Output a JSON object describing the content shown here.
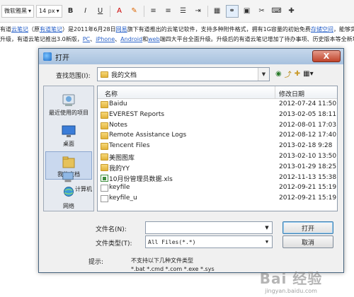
{
  "editor": {
    "font_name": "微软雅黑",
    "font_size": "14 px",
    "line1_parts": [
      "有道",
      "云笔记",
      "（原",
      "有道笔记",
      "）是2011年6月28日",
      "网易",
      "旗下有道推出的云笔记软件，支持多种附件格式，拥有1G容量的初始免费",
      "存储空间",
      "，能够实时"
    ],
    "line2_parts": [
      "升级，有道云笔记推出3.0新版，",
      "PC",
      "、",
      "iPhone",
      "、",
      "Android",
      "和",
      "web",
      "端四大平台全面升级。升级后的有道云笔记增加了待办事项、历史版本等全新功能，"
    ]
  },
  "dialog": {
    "title": "打开",
    "look_in_label": "查找范围(I):",
    "look_in_value": "我的文档",
    "places": [
      {
        "label": "最近使用的项目",
        "icon": "recent-icon"
      },
      {
        "label": "桌面",
        "icon": "desktop-icon"
      },
      {
        "label": "我的文档",
        "icon": "documents-icon"
      },
      {
        "label": "计算机",
        "icon": "computer-icon"
      },
      {
        "label": "网络",
        "icon": "network-icon"
      }
    ],
    "columns": {
      "name": "名称",
      "date": "修改日期"
    },
    "files": [
      {
        "name": "Baidu",
        "date": "2012-07-24 11:50",
        "type": "folder"
      },
      {
        "name": "EVEREST Reports",
        "date": "2013-02-05 18:11",
        "type": "folder"
      },
      {
        "name": "Notes",
        "date": "2012-08-01 17:03",
        "type": "folder"
      },
      {
        "name": "Remote Assistance Logs",
        "date": "2012-08-12 17:40",
        "type": "folder"
      },
      {
        "name": "Tencent Files",
        "date": "2013-02-18 9:28",
        "type": "folder"
      },
      {
        "name": "美图图库",
        "date": "2013-02-10 13:50",
        "type": "folder"
      },
      {
        "name": "我的YY",
        "date": "2013-01-29 18:25",
        "type": "folder"
      },
      {
        "name": "10月份管理员数据.xls",
        "date": "2012-11-13 15:38",
        "type": "xls"
      },
      {
        "name": "keyfile",
        "date": "2012-09-21 15:19",
        "type": "file"
      },
      {
        "name": "keyfile_u",
        "date": "2012-09-21 15:19",
        "type": "file"
      }
    ],
    "filename_label": "文件名(N):",
    "filename_value": "",
    "filetype_label": "文件类型(T):",
    "filetype_value": "All Files(*.*)",
    "open_button": "打开",
    "cancel_button": "取消",
    "hint_label": "提示:",
    "hint_line1": "不支持以下几种文件类型",
    "hint_line2": "*.bat *.cmd *.com *.exe *.sys",
    "close_label": "X"
  },
  "watermark": {
    "logo": "Bai 经验",
    "url": "jingyan.baidu.com"
  }
}
